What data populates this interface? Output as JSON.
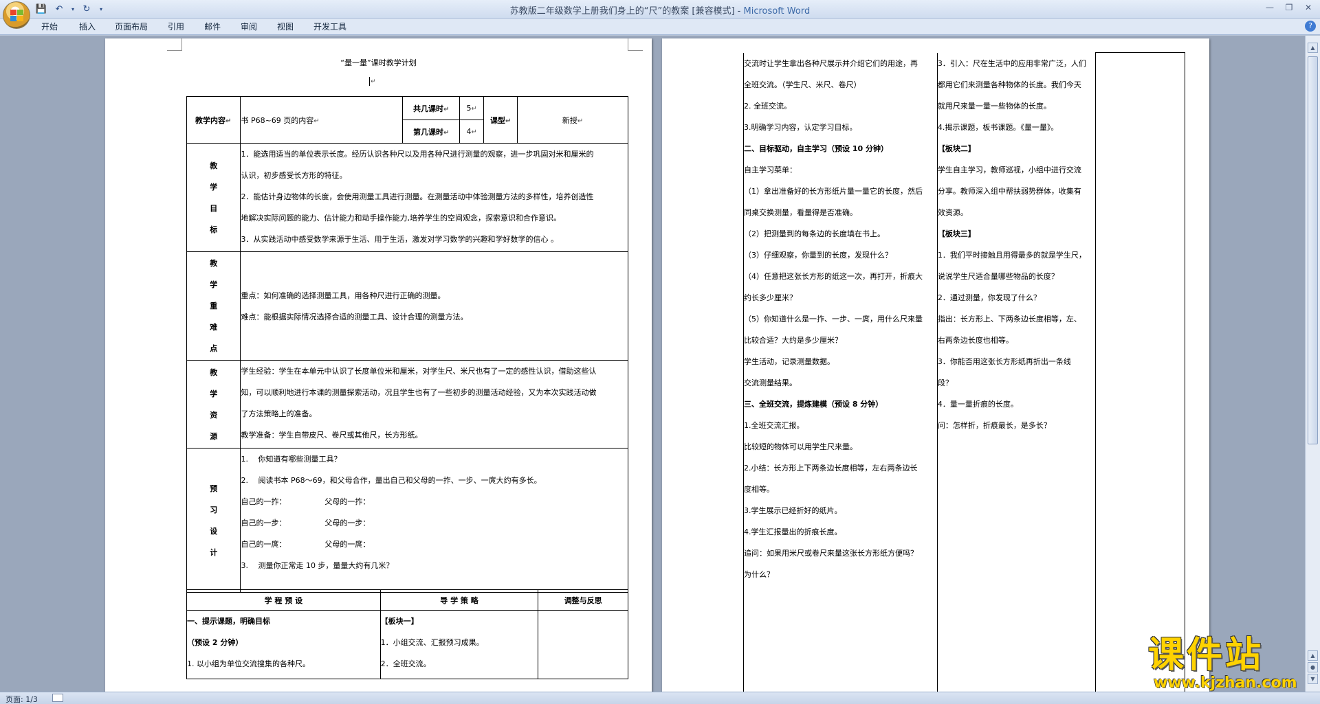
{
  "window": {
    "title_doc": "苏教版二年级数学上册我们身上的“尺”的教案 [兼容模式] - ",
    "title_app": "Microsoft Word"
  },
  "ribbon": {
    "tabs": [
      "开始",
      "插入",
      "页面布局",
      "引用",
      "邮件",
      "审阅",
      "视图",
      "开发工具"
    ]
  },
  "status": {
    "page": "页面: 1/3"
  },
  "watermark": {
    "title": "课件站",
    "url": "www.kjzhan.com"
  },
  "page1": {
    "heading": "“量一量”课时教学计划",
    "content_label": "教学内容",
    "content_value": "书 P68~69 页的内容",
    "total_hours_label": "共几课时",
    "total_hours_value": "5",
    "lesson_no_label": "第几课时",
    "lesson_no_value": "4",
    "type_label": "课型",
    "type_value": "新授",
    "goals_label": [
      "教",
      "学",
      "目",
      "标"
    ],
    "goals_lines": [
      "1．能选用适当的单位表示长度。经历认识各种尺以及用各种尺进行测量的观察，进一步巩固对米和厘米的",
      "认识，初步感受长方形的特征。",
      "2．能估计身边物体的长度，会使用测量工具进行测量。在测量活动中体验测量方法的多样性，培养创造性",
      "地解决实际问题的能力、估计能力和动手操作能力,培养学生的空间观念，探索意识和合作意识。",
      "3．从实践活动中感受数学来源于生活、用于生活，激发对学习数学的兴趣和学好数学的信心 。"
    ],
    "key_label": [
      "教",
      "学",
      "重",
      "难",
      "点"
    ],
    "key_lines": [
      "重点：如何准确的选择测量工具，用各种尺进行正确的测量。",
      "难点：能根据实际情况选择合适的测量工具、设计合理的测量方法。"
    ],
    "res_label": [
      "教",
      "学",
      "资",
      "源"
    ],
    "res_lines": [
      "学生经验：学生在本单元中认识了长度单位米和厘米，对学生尺、米尺也有了一定的感性认识，借助这些认",
      "知，可以顺利地进行本课的测量探索活动，况且学生也有了一些初步的测量活动经验，又为本次实践活动做",
      "了方法策略上的准备。",
      "教学准备：学生自带皮尺、卷尺或其他尺，长方形纸。"
    ],
    "pre_label": [
      "预",
      "习",
      "设",
      "计"
    ],
    "pre_lines": [
      "1.　 你知道有哪些测量工具？",
      "2.　 阅读书本 P68～69，和父母合作，量出自己和父母的一拃、一步、一庹大约有多长。",
      "自己的一拃：                父母的一拃：",
      "自己的一步：                父母的一步：",
      "自己的一庹：                父母的一庹：",
      "3.　 测量你正常走 10 步，量量大约有几米？"
    ],
    "col_headers": [
      "学 程 预 设",
      "导 学 策 略",
      "调整与反思"
    ],
    "left_lines": [
      "一、提示课题，明确目标",
      "（预设 2 分钟）",
      "1. 以小组为单位交流搜集的各种尺。"
    ],
    "mid_lines": [
      "【板块一】",
      "1．小组交流、汇报预习成果。",
      "2．全班交流。"
    ]
  },
  "page2": {
    "left_lines": [
      "交流时让学生拿出各种尺展示并介绍它们的用途，再",
      "全班交流。（学生尺、米尺、卷尺）",
      "2. 全班交流。",
      "3.明确学习内容，认定学习目标。",
      "",
      "二、目标驱动，自主学习（预设 10 分钟）",
      "自主学习菜单：",
      "（1）拿出准备好的长方形纸片量一量它的长度，然后",
      "同桌交换测量，看量得是否准确。",
      "（2）把测量到的每条边的长度填在书上。",
      "（3）仔细观察，你量到的长度，发现什么？",
      "（4）任意把这张长方形的纸这一次，再打开，折痕大",
      "约长多少厘米？",
      "（5）你知道什么是一拃、一步、一庹，用什么尺来量",
      "比较合适？大约是多少厘米？",
      "学生活动，记录测量数据。",
      "交流测量结果。",
      "",
      "三、全班交流，提炼建模（预设 8 分钟）",
      "1.全班交流汇报。",
      "比较短的物体可以用学生尺来量。",
      "",
      "2.小结：长方形上下两条边长度相等，左右两条边长",
      "度相等。",
      "",
      "3.学生展示已经折好的纸片。",
      "",
      "4.学生汇报量出的折痕长度。",
      "追问：如果用米尺或卷尺来量这张长方形纸方便吗？",
      "为什么？",
      ""
    ],
    "mid_lines": [
      "3．引入：尺在生活中的应用非常广泛，人们",
      "都用它们来测量各种物体的长度。我们今天",
      "就用尺来量一量一些物体的长度。",
      "4.揭示课题，板书课题。《量一量》。",
      "",
      "【板块二】",
      "学生自主学习，教师巡视，小组中进行交流",
      "分享。教师深入组中帮扶弱势群体，收集有",
      "效资源。",
      "",
      "",
      "",
      "",
      "",
      "",
      "",
      "",
      "",
      "",
      "",
      "【板块三】",
      "1．我们平时接触且用得最多的就是学生尺，",
      "说说学生尺适合量哪些物品的长度？",
      "2．通过测量，你发现了什么？",
      "指出：长方形上、下两条边长度相等，左、",
      "右两条边长度也相等。",
      "3．你能否用这张长方形纸再折出一条线",
      "段？",
      "4．量一量折痕的长度。",
      "问：怎样折，折痕最长，是多长？"
    ]
  }
}
